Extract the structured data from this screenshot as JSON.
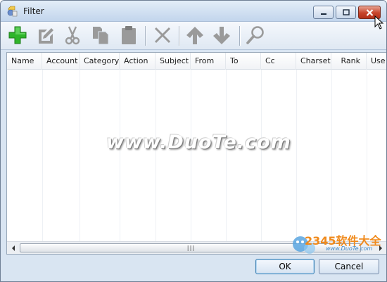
{
  "window": {
    "title": "Filter"
  },
  "toolbar": {
    "buttons": [
      {
        "icon": "add-icon"
      },
      {
        "icon": "edit-icon"
      },
      {
        "icon": "cut-icon"
      },
      {
        "icon": "copy-icon"
      },
      {
        "icon": "paste-icon"
      },
      {
        "icon": "delete-icon"
      },
      {
        "icon": "arrow-up-icon"
      },
      {
        "icon": "arrow-down-icon"
      },
      {
        "icon": "search-icon"
      }
    ]
  },
  "list": {
    "columns": [
      "Name",
      "Account",
      "Category",
      "Action",
      "Subject",
      "From",
      "To",
      "Cc",
      "Charset",
      "Rank",
      "Use"
    ],
    "rows": []
  },
  "watermark": "www.DuoTe.com",
  "logo": {
    "brand": "2345软件大全",
    "url": "www.DuoTe.com"
  },
  "dialog": {
    "ok_label": "OK",
    "cancel_label": "Cancel"
  },
  "colors": {
    "accent": "#3c7fb1",
    "close": "#c7442b",
    "add_icon": "#2fb52b"
  }
}
